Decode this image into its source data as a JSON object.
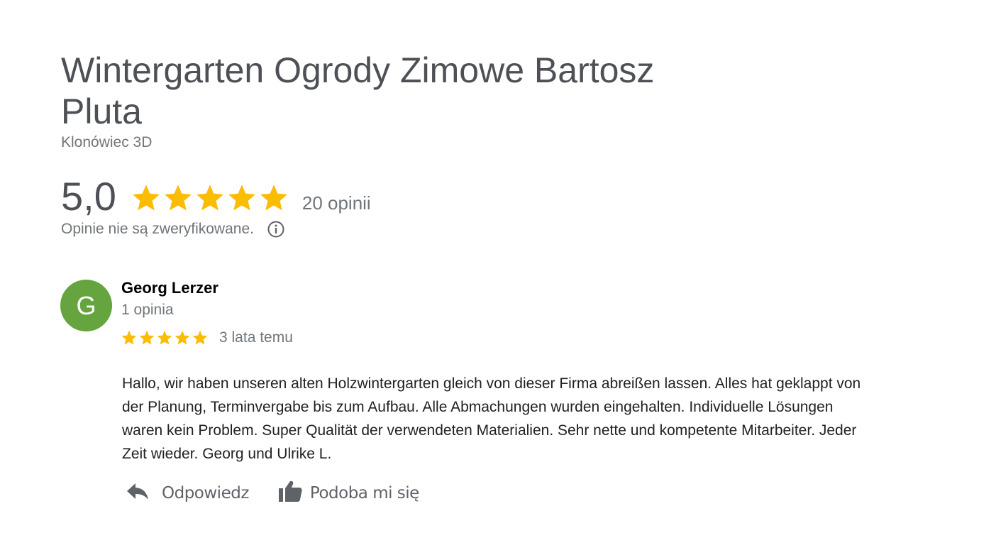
{
  "business": {
    "title": "Wintergarten Ogrody Zimowe Bartosz Pluta",
    "subtitle": "Klonówiec 3D"
  },
  "rating": {
    "value": "5,0",
    "stars": 5,
    "count_label": "20 opinii",
    "verification_text": "Opinie nie są zweryfikowane."
  },
  "colors": {
    "star": "#fbbc04",
    "avatar_bg": "#66a43f",
    "muted_text": "#70757a",
    "title_text": "#4d5156"
  },
  "review": {
    "avatar_letter": "G",
    "author": "Georg Lerzer",
    "author_reviews": "1 opinia",
    "stars": 5,
    "date": "3 lata temu",
    "text": "Hallo, wir haben unseren alten Holzwintergarten gleich von dieser Firma abreißen lassen. Alles hat geklappt von der Planung, Terminvergabe bis zum Aufbau. Alle Abmachungen wurden eingehalten. Individuelle Lösungen waren kein Problem. Super Qualität der verwendeten Materialien. Sehr nette und kompetente Mitarbeiter. Jeder Zeit wieder. Georg und Ulrike L."
  },
  "actions": {
    "reply_label": "Odpowiedz",
    "reply_icon": "reply-arrow-icon",
    "like_label": "Podoba mi się",
    "like_icon": "thumbs-up-icon"
  }
}
